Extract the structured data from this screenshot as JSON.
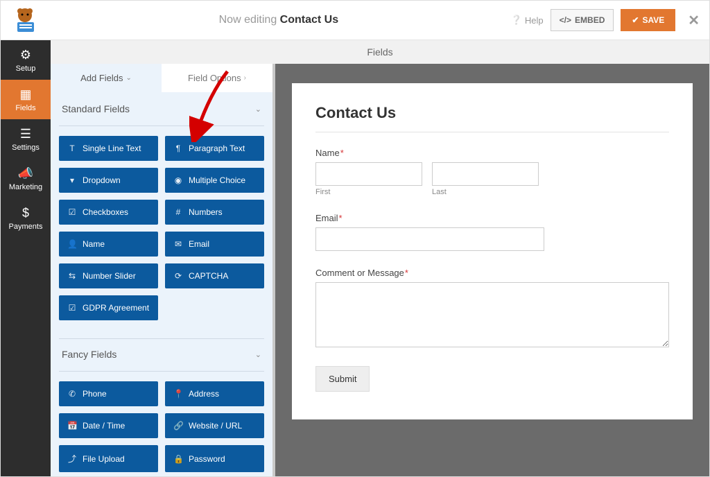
{
  "header": {
    "editing_prefix": "Now editing",
    "form_name": "Contact Us",
    "help": "Help",
    "embed": "EMBED",
    "save": "SAVE"
  },
  "strip": {
    "title": "Fields"
  },
  "rail": {
    "items": [
      {
        "label": "Setup",
        "icon": "⚙"
      },
      {
        "label": "Fields",
        "icon": "▦"
      },
      {
        "label": "Settings",
        "icon": "☰"
      },
      {
        "label": "Marketing",
        "icon": "📣"
      },
      {
        "label": "Payments",
        "icon": "$"
      }
    ]
  },
  "tabs": {
    "add_fields": "Add Fields",
    "field_options": "Field Options"
  },
  "sections": {
    "standard": {
      "title": "Standard Fields"
    },
    "fancy": {
      "title": "Fancy Fields"
    }
  },
  "standard_fields": [
    {
      "label": "Single Line Text",
      "icon": "T"
    },
    {
      "label": "Paragraph Text",
      "icon": "¶"
    },
    {
      "label": "Dropdown",
      "icon": "▾"
    },
    {
      "label": "Multiple Choice",
      "icon": "◉"
    },
    {
      "label": "Checkboxes",
      "icon": "☑"
    },
    {
      "label": "Numbers",
      "icon": "#"
    },
    {
      "label": "Name",
      "icon": "👤"
    },
    {
      "label": "Email",
      "icon": "✉"
    },
    {
      "label": "Number Slider",
      "icon": "⇆"
    },
    {
      "label": "CAPTCHA",
      "icon": "⟳"
    },
    {
      "label": "GDPR Agreement",
      "icon": "☑"
    }
  ],
  "fancy_fields": [
    {
      "label": "Phone",
      "icon": "✆"
    },
    {
      "label": "Address",
      "icon": "📍"
    },
    {
      "label": "Date / Time",
      "icon": "📅"
    },
    {
      "label": "Website / URL",
      "icon": "🔗"
    },
    {
      "label": "File Upload",
      "icon": "⤴"
    },
    {
      "label": "Password",
      "icon": "🔒"
    }
  ],
  "preview": {
    "title": "Contact Us",
    "name_label": "Name",
    "first": "First",
    "last": "Last",
    "email_label": "Email",
    "comment_label": "Comment or Message",
    "submit": "Submit"
  }
}
